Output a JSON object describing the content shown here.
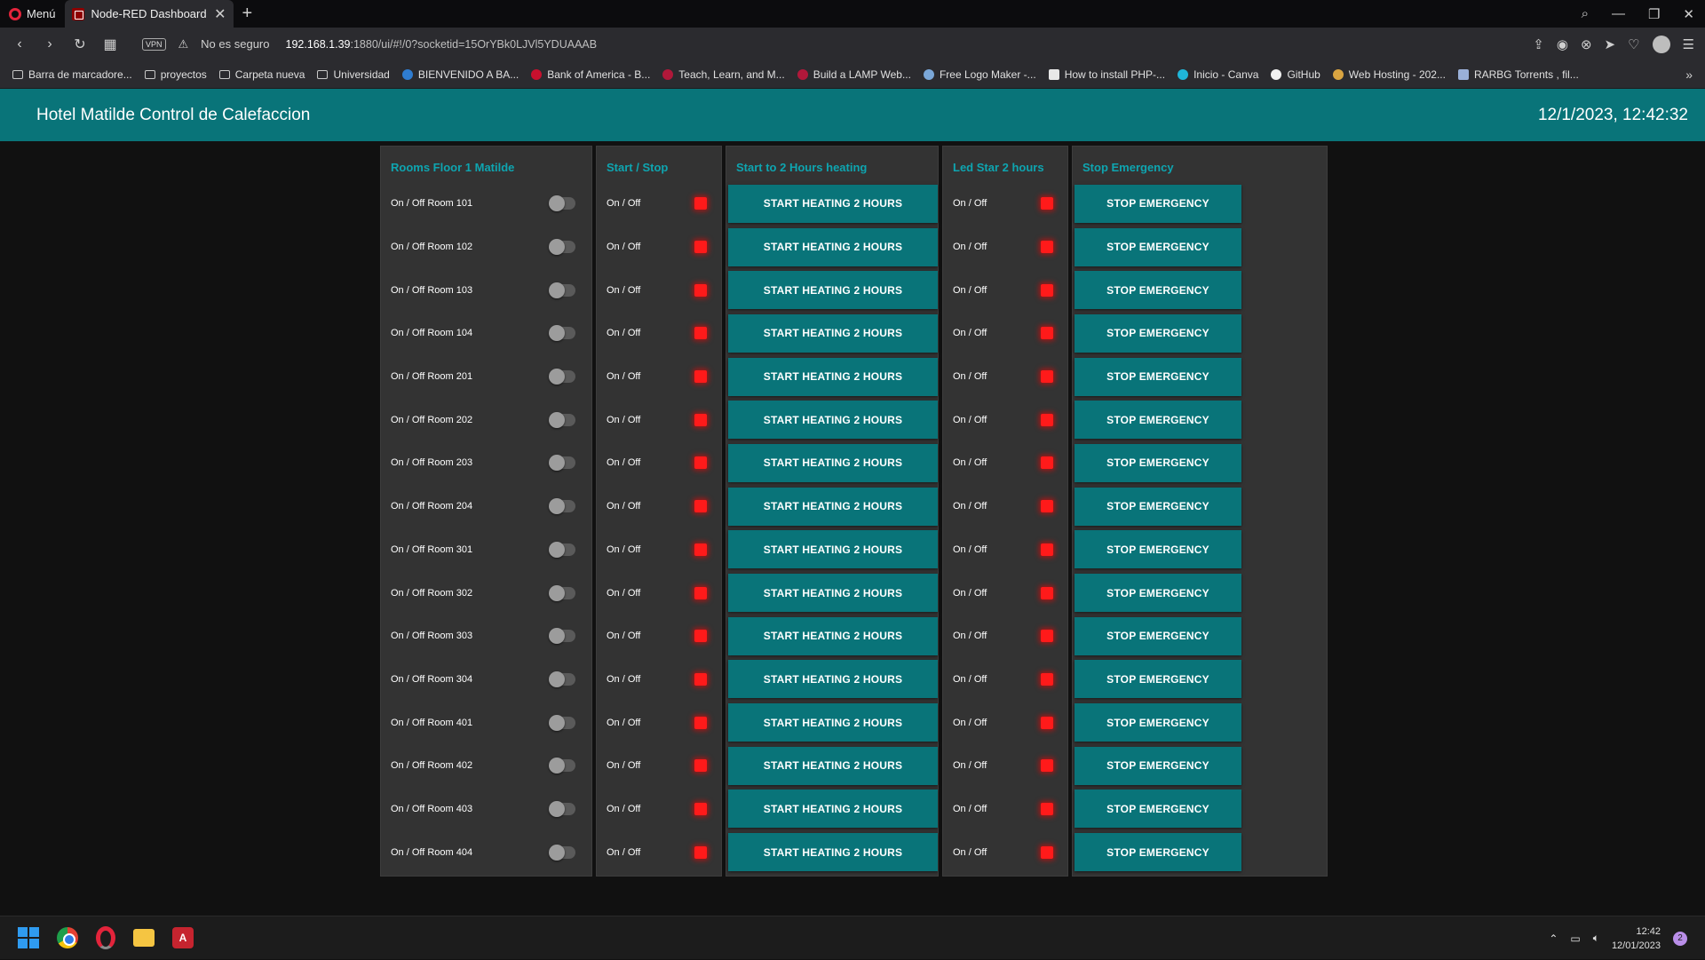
{
  "browser": {
    "menu_label": "Menú",
    "tab_title": "Node-RED Dashboard",
    "vpn_label": "VPN",
    "security_label": "No es seguro",
    "url_host": "192.168.1.39",
    "url_rest": ":1880/ui/#!/0?socketid=15OrYBk0LJVl5YDUAAAB",
    "bookmarks": [
      "Barra de marcadore...",
      "proyectos",
      "Carpeta nueva",
      "Universidad",
      "BIENVENIDO A BA...",
      "Bank of America - B...",
      "Teach, Learn, and M...",
      "Build a LAMP Web...",
      "Free Logo Maker -...",
      "How to install PHP-...",
      "Inicio - Canva",
      "GitHub",
      "Web Hosting - 202...",
      "RARBG Torrents , fil..."
    ]
  },
  "dashboard": {
    "title": "Hotel Matilde Control de Calefaccion",
    "clock": "12/1/2023, 12:42:32",
    "accent_color": "#097479",
    "led_color": "#ff1a1a"
  },
  "groups": {
    "rooms": {
      "title": "Rooms Floor 1 Matilde",
      "items": [
        {
          "label": "On / Off Room 101",
          "on": false
        },
        {
          "label": "On / Off Room 102",
          "on": false
        },
        {
          "label": "On / Off Room 103",
          "on": false
        },
        {
          "label": "On / Off Room 104",
          "on": false
        },
        {
          "label": "On / Off Room 201",
          "on": false
        },
        {
          "label": "On / Off Room 202",
          "on": false
        },
        {
          "label": "On / Off Room 203",
          "on": false
        },
        {
          "label": "On / Off Room 204",
          "on": false
        },
        {
          "label": "On / Off Room 301",
          "on": false
        },
        {
          "label": "On / Off Room 302",
          "on": false
        },
        {
          "label": "On / Off Room 303",
          "on": false
        },
        {
          "label": "On / Off Room 304",
          "on": false
        },
        {
          "label": "On / Off Room 401",
          "on": false
        },
        {
          "label": "On / Off Room 402",
          "on": false
        },
        {
          "label": "On / Off Room 403",
          "on": false
        },
        {
          "label": "On / Off Room 404",
          "on": false
        }
      ]
    },
    "start_stop": {
      "title": "Start / Stop",
      "item_label": "On / Off"
    },
    "heating": {
      "title": "Start to 2 Hours heating",
      "button_label": "START HEATING 2 HOURS"
    },
    "led": {
      "title": "Led Star 2 hours",
      "item_label": "On / Off"
    },
    "emergency": {
      "title": "Stop Emergency",
      "button_label": "STOP EMERGENCY"
    }
  },
  "taskbar": {
    "time": "12:42",
    "date": "12/01/2023",
    "notifications": "2"
  }
}
